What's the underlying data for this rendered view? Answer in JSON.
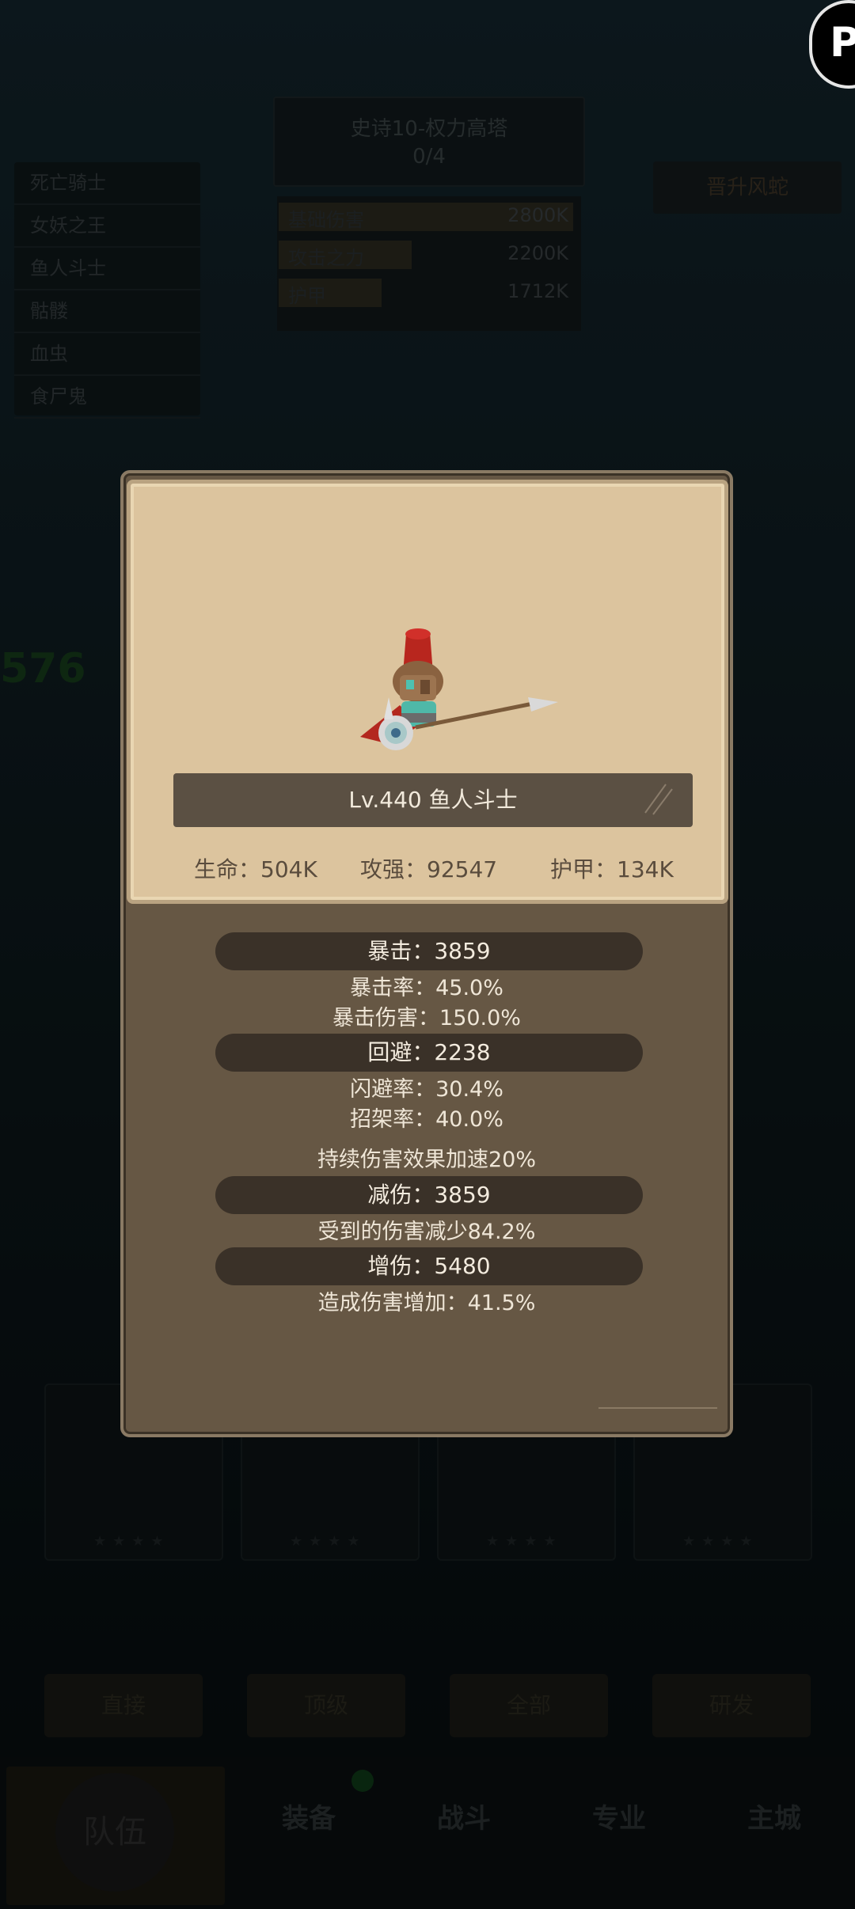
{
  "background": {
    "title_line1": "史诗10-权力高塔",
    "title_line2": "0/4",
    "enemy_list": [
      "死亡骑士",
      "女妖之王",
      "鱼人斗士",
      "骷髅",
      "血虫",
      "食尸鬼"
    ],
    "upgrade_button": "晋升风蛇",
    "stats": [
      {
        "label": "基础伤害",
        "value": "2800K"
      },
      {
        "label": "攻击之力",
        "value": "2200K"
      },
      {
        "label": "护甲",
        "value": "1712K"
      }
    ],
    "green_number": "576",
    "actions": [
      "直接",
      "顶级",
      "全部",
      "研发"
    ],
    "tabs": [
      "队伍",
      "装备",
      "战斗",
      "专业",
      "主城"
    ]
  },
  "corner_button_label": "P",
  "popup": {
    "name": "Lv.440 鱼人斗士",
    "base_stats": {
      "hp": "生命：504K",
      "attack": "攻强：92547",
      "armor": "护甲：134K"
    },
    "sections": {
      "crit": {
        "header": "暴击：3859",
        "lines": [
          "暴击率：45.0%",
          "暴击伤害：150.0%"
        ]
      },
      "dodge": {
        "header": "回避：2238",
        "lines": [
          "闪避率：30.4%",
          "招架率：40.0%"
        ]
      },
      "dot": "持续伤害效果加速20%",
      "reduce": {
        "header": "减伤：3859",
        "lines": [
          "受到的伤害减少84.2%"
        ]
      },
      "increase": {
        "header": "增伤：5480",
        "lines": [
          "造成伤害增加：41.5%"
        ]
      }
    }
  },
  "colors": {
    "popup_bg": "#665744",
    "portrait_bg": "#dcc49e",
    "pill_bg": "#3a3128",
    "text_light": "#efe6d7"
  }
}
